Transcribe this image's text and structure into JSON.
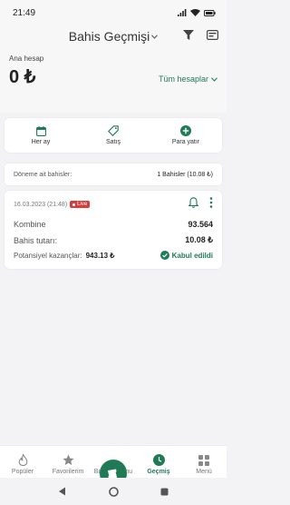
{
  "status_bar": {
    "time": "21:49",
    "battery": "battery-icon",
    "wifi": "wifi-icon",
    "signal": "signal-icon"
  },
  "header": {
    "title": "Bahis Geçmişi"
  },
  "account": {
    "label": "Ana hesap",
    "balance": "0 ₺",
    "selector": "Tüm hesaplar"
  },
  "actions": [
    {
      "label": "Her ay",
      "icon": "calendar-icon"
    },
    {
      "label": "Satış",
      "icon": "tag-icon"
    },
    {
      "label": "Para yatır",
      "icon": "plus-circle-icon"
    }
  ],
  "summary": {
    "label": "Döneme ait bahisler:",
    "value": "1 Bahisler (10.08 ₺)"
  },
  "bet": {
    "date": "16.03.2023 (21:48)",
    "live": "Live",
    "type_label": "Kombine",
    "type_value": "93.564",
    "stake_label": "Bahis tutarı:",
    "stake_value": "10.08 ₺",
    "potential_label": "Potansiyel kazançlar:",
    "potential_value": "943.13 ₺",
    "status": "Kabul edildi"
  },
  "nav": [
    {
      "label": "Popüler",
      "icon": "fire-icon"
    },
    {
      "label": "Favorilerim",
      "icon": "star-icon"
    },
    {
      "label": "Bahis kuponu",
      "icon": "ticket-icon"
    },
    {
      "label": "Geçmiş",
      "icon": "clock-icon"
    },
    {
      "label": "Menü",
      "icon": "grid-icon"
    }
  ],
  "colors": {
    "accent": "#1f7a55",
    "live": "#d63c3c",
    "background": "#f3f3f5"
  }
}
